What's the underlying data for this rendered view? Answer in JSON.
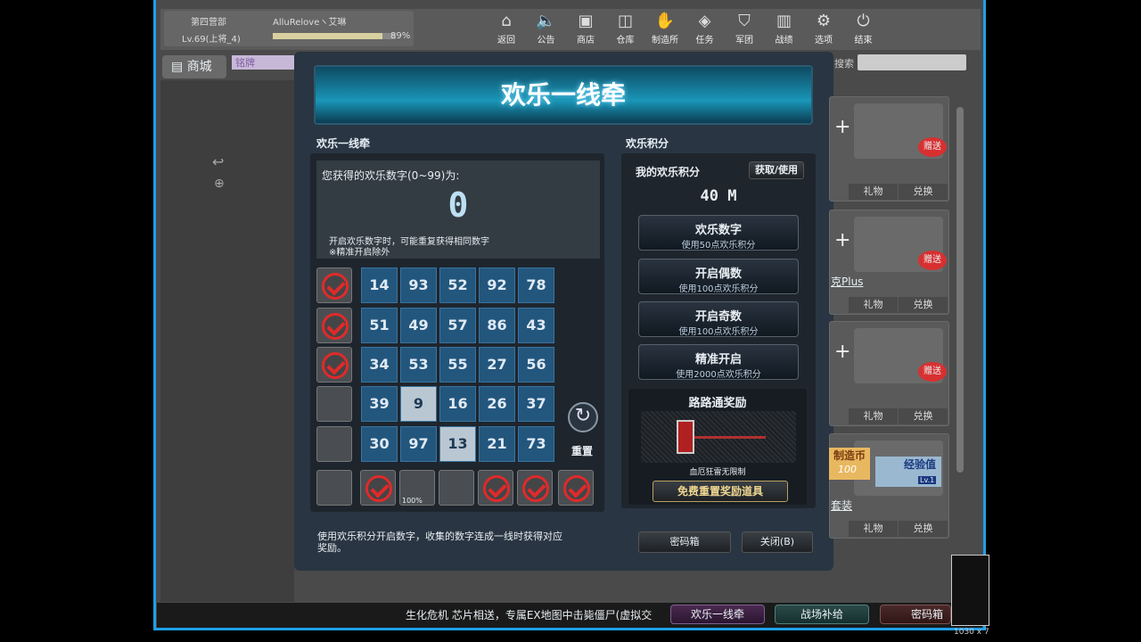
{
  "topbar": {
    "unit": "第四营部",
    "player": "AlluReloveヽ艾琳",
    "level": "Lv.69(上将_4)",
    "exp_percent": 89,
    "exp_label": "89%",
    "nav": [
      {
        "label": "返回",
        "icon": "home-icon",
        "glyph": "⌂"
      },
      {
        "label": "公告",
        "icon": "speaker-icon",
        "glyph": "🔈"
      },
      {
        "label": "商店",
        "icon": "shop-icon",
        "glyph": "▣"
      },
      {
        "label": "仓库",
        "icon": "bag-icon",
        "glyph": "◫"
      },
      {
        "label": "制造所",
        "icon": "glove-icon",
        "glyph": "✋"
      },
      {
        "label": "任务",
        "icon": "ticket-icon",
        "glyph": "◈"
      },
      {
        "label": "军团",
        "icon": "shield-icon",
        "glyph": "⛉"
      },
      {
        "label": "战绩",
        "icon": "chart-icon",
        "glyph": "▥"
      },
      {
        "label": "选项",
        "icon": "gear-icon",
        "glyph": "⚙"
      },
      {
        "label": "结束",
        "icon": "power-icon",
        "glyph": "⏻"
      }
    ]
  },
  "shop": {
    "title": "商城",
    "tab": "铭牌",
    "search_label": "搜索",
    "search_value": ""
  },
  "modal": {
    "title": "欢乐一线牵",
    "left": {
      "section": "欢乐一线牵",
      "prompt": "您获得的欢乐数字(0~99)为:",
      "current_number": "0",
      "note1": "开启欢乐数字时，可能重复获得相同数字",
      "note2": "※精准开启除外",
      "grid": [
        [
          14,
          93,
          52,
          92,
          78
        ],
        [
          51,
          49,
          57,
          86,
          43
        ],
        [
          34,
          53,
          55,
          27,
          56
        ],
        [
          39,
          9,
          16,
          26,
          37
        ],
        [
          30,
          97,
          13,
          21,
          73
        ]
      ],
      "highlighted": [
        9,
        13
      ],
      "row_checked": [
        true,
        true,
        true,
        false,
        false
      ],
      "bottom_checked": [
        false,
        true,
        false,
        false,
        true,
        true,
        true
      ],
      "bottom_badge": "100%",
      "reset_label": "重置",
      "footer": "使用欢乐积分开启数字，收集的数字连成一线时获得对应奖励。"
    },
    "right": {
      "section": "欢乐积分",
      "my_points_label": "我的欢乐积分",
      "get_use_button": "获取/使用",
      "points": "40 M",
      "actions": [
        {
          "title": "欢乐数字",
          "sub": "使用50点欢乐积分"
        },
        {
          "title": "开启偶数",
          "sub": "使用100点欢乐积分"
        },
        {
          "title": "开启奇数",
          "sub": "使用100点欢乐积分"
        },
        {
          "title": "精准开启",
          "sub": "使用2000点欢乐积分"
        }
      ],
      "reward_title": "路路通奖励",
      "reward_name": "血厄狂雷无限制",
      "reward_reset_button": "免费重置奖励道具",
      "password_box_button": "密码箱",
      "close_button": "关闭(B)"
    }
  },
  "cards": [
    {
      "badge": "赠送",
      "gift": "礼物",
      "exchange": "兑换"
    },
    {
      "badge": "赠送",
      "name": "克Plus",
      "gift": "礼物",
      "exchange": "兑换"
    },
    {
      "badge": "赠送",
      "gift": "礼物",
      "exchange": "兑换"
    },
    {
      "coin": "制造币",
      "coin_amount": "100",
      "exp": "经验值",
      "exp_lv": "Lv.1",
      "name": "套装",
      "gift": "礼物",
      "exchange": "兑换"
    }
  ],
  "bottom": {
    "ticker": "生化危机 芯片相送，专属EX地图中击毙僵尸(虚拟交",
    "tabs": [
      "欢乐一线牵",
      "战场补给",
      "密码箱"
    ]
  },
  "overlay_text": "1030 x 7",
  "colors": {
    "accent": "#1fa0e8",
    "cell": "#23567d",
    "check": "#e02a2a"
  }
}
